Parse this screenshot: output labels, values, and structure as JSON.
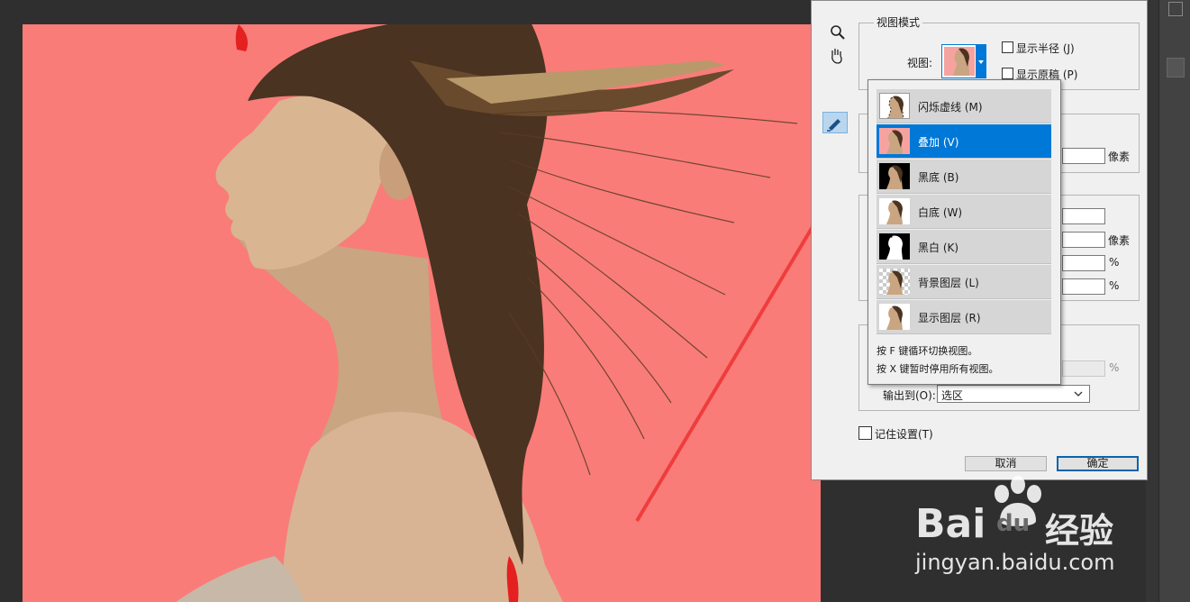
{
  "dialog": {
    "view_mode_group": {
      "title": "视图模式",
      "view_label": "视图:",
      "show_radius_label": "显示半径 (J)",
      "show_original_label": "显示原稿 (P)"
    },
    "units": {
      "pixels_1": "像素",
      "pixels_2": "像素",
      "percent_1": "%",
      "percent_2": "%",
      "percent_3": "%"
    },
    "output_to_label": "输出到(O):",
    "output_to_value": "选区",
    "remember_settings_label": "记住设置(T)",
    "cancel_label": "取消",
    "ok_label": "确定"
  },
  "view_dropdown": {
    "items": [
      {
        "label": "闪烁虚线 (M)",
        "thumb": "marching-ants"
      },
      {
        "label": "叠加 (V)",
        "thumb": "overlay",
        "selected": true
      },
      {
        "label": "黑底 (B)",
        "thumb": "on-black"
      },
      {
        "label": "白底 (W)",
        "thumb": "on-white"
      },
      {
        "label": "黑白 (K)",
        "thumb": "black-white"
      },
      {
        "label": "背景图层 (L)",
        "thumb": "on-layers"
      },
      {
        "label": "显示图层 (R)",
        "thumb": "reveal-layer"
      }
    ],
    "hint_1": "按 F 键循环切换视图。",
    "hint_2": "按 X 键暂时停用所有视图。"
  },
  "tools": [
    "zoom-tool-icon",
    "hand-tool-icon",
    "refine-radius-brush-icon"
  ],
  "watermark": {
    "brand": "Bai",
    "brand_du": "du",
    "brand_cn": "经验",
    "url": "jingyan.baidu.com"
  },
  "colors": {
    "overlay_red": "#f97c79",
    "selection_blue": "#0078d7",
    "annotation_arrow": "#f03c3c"
  }
}
